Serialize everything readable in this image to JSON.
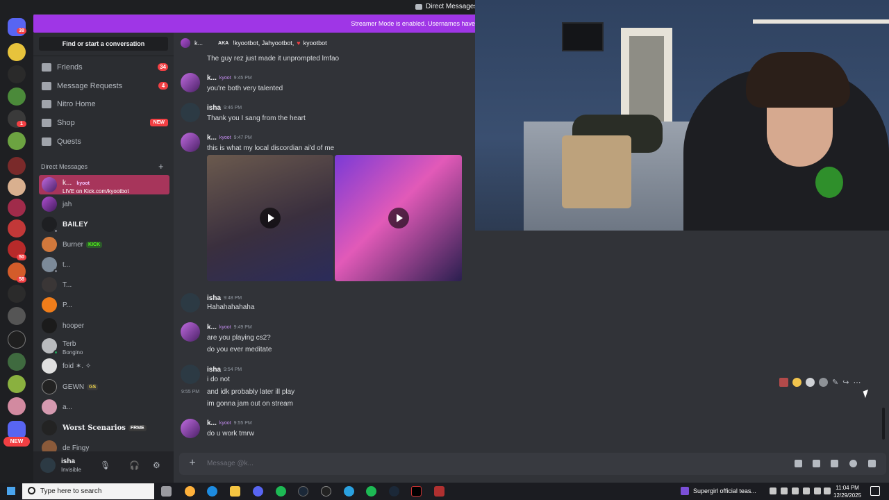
{
  "window": {
    "title": "Direct Messages"
  },
  "banner": {
    "text": "Streamer Mode is enabled. Usernames have"
  },
  "rail": {
    "badges": [
      "38",
      "1",
      "50",
      "58"
    ],
    "new_label": "NEW"
  },
  "dm_sidebar": {
    "find_button": "Find or start a conversation",
    "nav": [
      {
        "label": "Friends",
        "count": "34",
        "icon": "friends-icon"
      },
      {
        "label": "Message Requests",
        "count": "4",
        "icon": "message-requests-icon"
      },
      {
        "label": "Nitro Home",
        "icon": "nitro-icon"
      },
      {
        "label": "Shop",
        "badge": "NEW",
        "icon": "shop-icon"
      },
      {
        "label": "Quests",
        "icon": "quests-icon"
      }
    ],
    "dm_header": "Direct Messages",
    "dms": [
      {
        "name": "k...",
        "tag": "kyoot",
        "sub": "LIVE on Kick.com/kyootbot",
        "active": true
      },
      {
        "name": "jah"
      },
      {
        "name": "BAILEY"
      },
      {
        "name": "Burner",
        "tag": "KICK"
      },
      {
        "name": "t..."
      },
      {
        "name": "T..."
      },
      {
        "name": "P..."
      },
      {
        "name": "hooper"
      },
      {
        "name": "Terb",
        "sub": "Bongino"
      },
      {
        "name": "foid ✶. ✧"
      },
      {
        "name": "GEWN",
        "tag": "GS"
      },
      {
        "name": "a..."
      },
      {
        "name": "Worst Scenarios",
        "tag": "FRME"
      },
      {
        "name": "de Fingy"
      }
    ]
  },
  "user_panel": {
    "name": "isha",
    "status": "Invisible"
  },
  "chat": {
    "header": {
      "name": "k...",
      "aka": "AKA",
      "aliases": "!kyootbot, Jahyootbot,",
      "last_alias": "kyootbot"
    },
    "messages": [
      {
        "text": "The guy rez just made it unprompted lmfao"
      },
      {
        "author": "k...",
        "tag": "kyoot",
        "time": "9:45 PM",
        "text": "you're both very talented"
      },
      {
        "author": "isha",
        "time": "9:46 PM",
        "text": "Thank you I sang from the heart"
      },
      {
        "author": "k...",
        "tag": "kyoot",
        "time": "9:47 PM",
        "text": "this is what my local discordian ai'd of me"
      },
      {
        "author": "isha",
        "time": "9:48 PM",
        "text": "Hahahahahaha"
      },
      {
        "author": "k...",
        "tag": "kyoot",
        "time": "9:49 PM",
        "text": "are you playing cs2?"
      },
      {
        "text": "do you ever meditate"
      },
      {
        "author": "isha",
        "time": "9:54 PM",
        "text": "i do not"
      },
      {
        "time": "9:55 PM",
        "text": "and idk  probably later ill play"
      },
      {
        "text": "im gonna jam out on stream"
      },
      {
        "author": "k...",
        "tag": "kyoot",
        "time": "9:55 PM",
        "text": "do u work tmrw"
      }
    ],
    "composer_placeholder": "Message @k..."
  },
  "taskbar": {
    "search_placeholder": "Type here to search",
    "media_title": "Supergirl official teas...",
    "time": "11:04 PM",
    "date": "12/29/2025"
  },
  "colors": {
    "accent": "#9f36e6",
    "active_dm": "#a7355b",
    "badge": "#f23f43"
  }
}
